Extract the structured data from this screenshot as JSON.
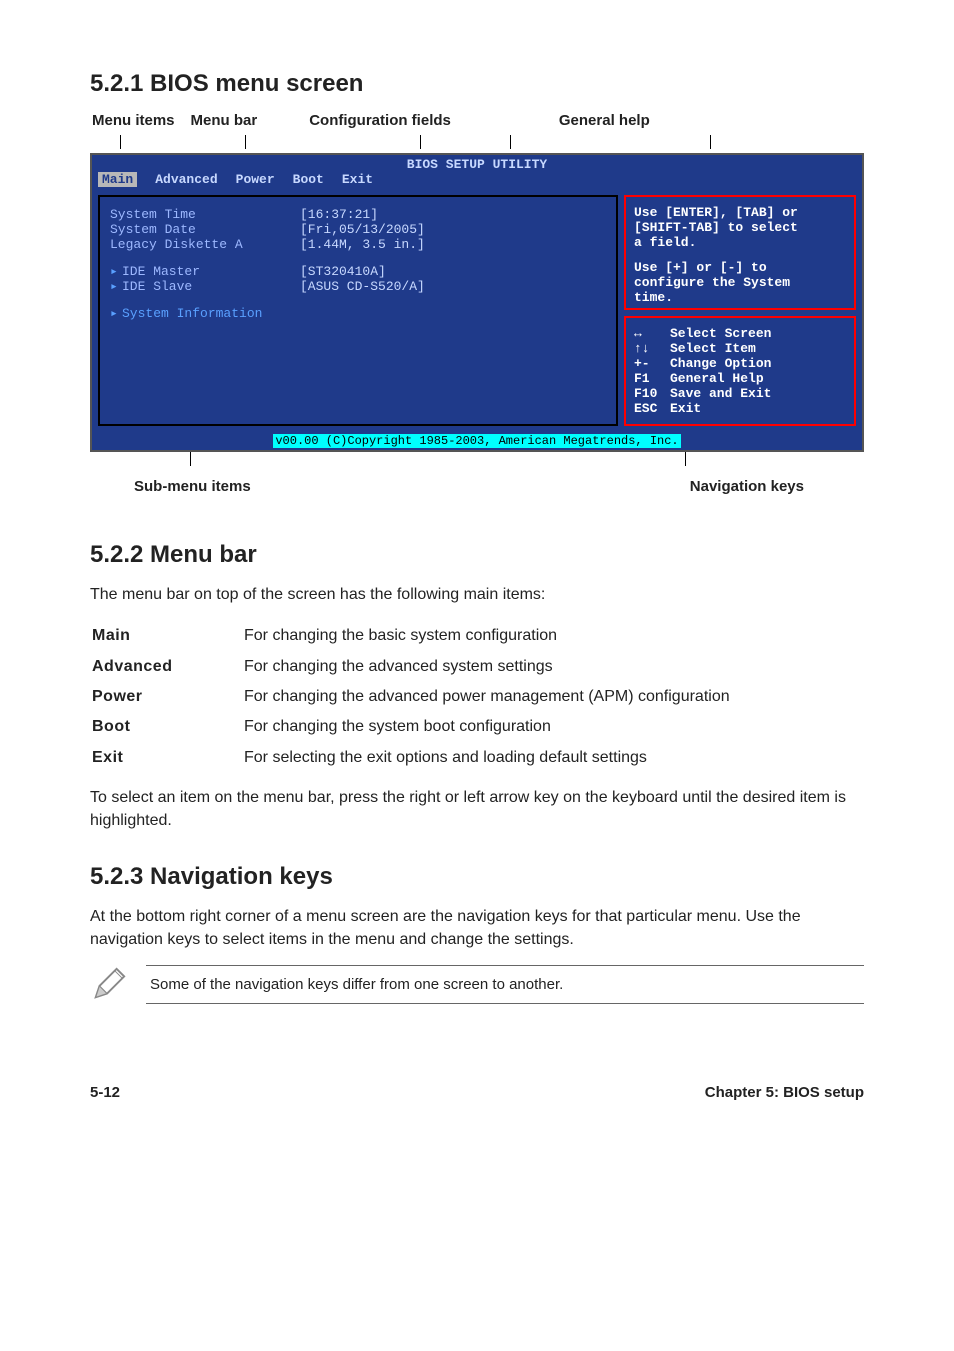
{
  "section1": {
    "heading": "5.2.1   BIOS menu screen",
    "labels": {
      "menu_items": "Menu items",
      "menu_bar": "Menu bar",
      "config_fields": "Configuration fields",
      "general_help": "General help",
      "sub_menu_items": "Sub-menu items",
      "navigation_keys": "Navigation keys"
    }
  },
  "bios": {
    "title": "BIOS SETUP UTILITY",
    "menu_bar": {
      "items": [
        "Main",
        "Advanced",
        "Power",
        "Boot",
        "Exit"
      ],
      "active": "Main"
    },
    "left": {
      "rows": [
        {
          "key": "System Time",
          "val": "[16:37:21]"
        },
        {
          "key": "System Date",
          "val": "[Fri,05/13/2005]"
        },
        {
          "key": "Legacy Diskette A",
          "val": "[1.44M, 3.5 in.]"
        }
      ],
      "ide": [
        {
          "key": "IDE Master",
          "val": "[ST320410A]"
        },
        {
          "key": "IDE Slave",
          "val": "[ASUS CD-S520/A]"
        }
      ],
      "submenu": "System Information"
    },
    "help": {
      "line1": "Use [ENTER], [TAB] or",
      "line2": "[SHIFT-TAB] to select",
      "line3": "a field.",
      "line4": "Use [+] or [-] to",
      "line5": "configure the System",
      "line6": "time."
    },
    "nav": [
      {
        "k": "↔",
        "t": "Select Screen"
      },
      {
        "k": "↑↓",
        "t": "Select Item"
      },
      {
        "k": "+-",
        "t": "Change Option"
      },
      {
        "k": "F1",
        "t": "General Help"
      },
      {
        "k": "F10",
        "t": "Save and Exit"
      },
      {
        "k": "ESC",
        "t": "Exit"
      }
    ],
    "footer": "v00.00 (C)Copyright 1985-2003, American Megatrends, Inc."
  },
  "section2": {
    "heading": "5.2.2   Menu bar",
    "intro": "The menu bar on top of the screen has the following main items:",
    "items": [
      {
        "key": "Main",
        "desc": "For changing the basic system configuration"
      },
      {
        "key": "Advanced",
        "desc": "For changing the advanced system settings"
      },
      {
        "key": "Power",
        "desc": "For changing the advanced power management (APM) configuration"
      },
      {
        "key": "Boot",
        "desc": "For changing the system boot configuration"
      },
      {
        "key": "Exit",
        "desc": "For selecting the exit options and loading default settings"
      }
    ],
    "outro": "To select an item on the menu bar, press the right or left arrow key on the keyboard until the desired item is highlighted."
  },
  "section3": {
    "heading": "5.2.3   Navigation keys",
    "para": "At the bottom right corner of a menu screen are the navigation keys for that particular menu. Use the navigation keys to select items in the menu and change the settings.",
    "note": "Some of the navigation keys differ from one screen to another."
  },
  "footer": {
    "left": "5-12",
    "right": "Chapter 5: BIOS setup"
  }
}
